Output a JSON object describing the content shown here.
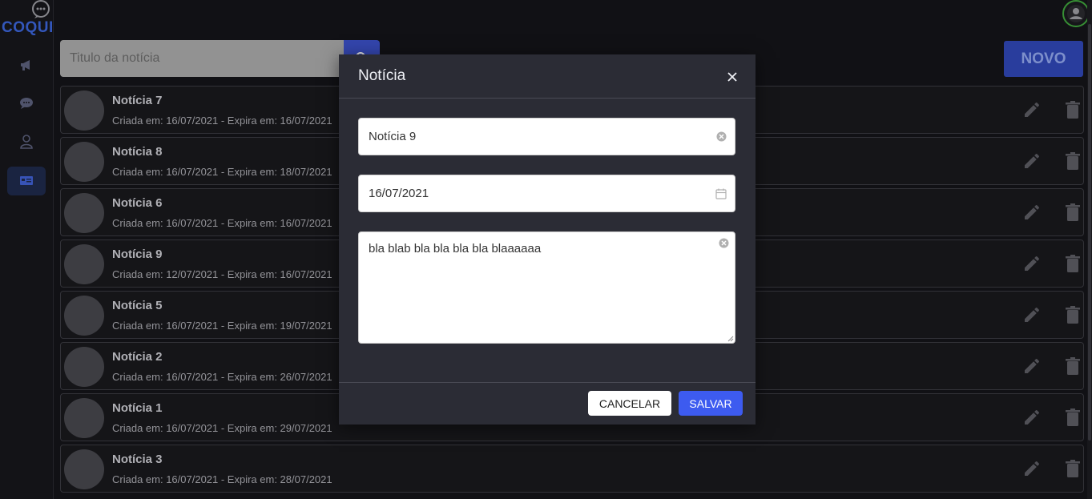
{
  "app": {
    "logo_text": "COQUI"
  },
  "sidebar": {
    "items": [
      {
        "icon": "megaphone-icon"
      },
      {
        "icon": "chat-icon"
      },
      {
        "icon": "user-icon"
      },
      {
        "icon": "news-icon",
        "active": true
      }
    ]
  },
  "search": {
    "placeholder": "Titulo da notícia"
  },
  "toolbar": {
    "new_label": "NOVO"
  },
  "news": [
    {
      "title": "Notícia 7",
      "meta": "Criada em: 16/07/2021 - Expira em: 16/07/2021"
    },
    {
      "title": "Notícia 8",
      "meta": "Criada em: 16/07/2021 - Expira em: 18/07/2021"
    },
    {
      "title": "Notícia 6",
      "meta": "Criada em: 16/07/2021 - Expira em: 16/07/2021"
    },
    {
      "title": "Notícia 9",
      "meta": "Criada em: 12/07/2021 - Expira em: 16/07/2021"
    },
    {
      "title": "Notícia 5",
      "meta": "Criada em: 16/07/2021 - Expira em: 19/07/2021"
    },
    {
      "title": "Notícia 2",
      "meta": "Criada em: 16/07/2021 - Expira em: 26/07/2021"
    },
    {
      "title": "Notícia 1",
      "meta": "Criada em: 16/07/2021 - Expira em: 29/07/2021"
    },
    {
      "title": "Notícia 3",
      "meta": "Criada em: 16/07/2021 - Expira em: 28/07/2021"
    }
  ],
  "modal": {
    "title": "Notícia",
    "title_value": "Notícia 9",
    "date_value": "16/07/2021",
    "body_value": "bla blab bla bla bla bla blaaaaaa",
    "cancel_label": "CANCELAR",
    "save_label": "SALVAR"
  },
  "colors": {
    "accent": "#3d5bf0",
    "logo": "#3b63d6",
    "online": "#3fa33c"
  }
}
